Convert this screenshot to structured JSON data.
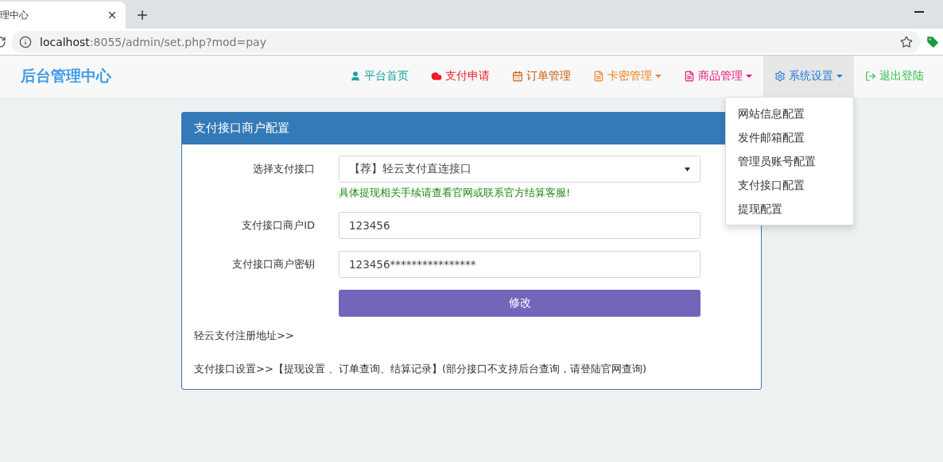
{
  "browser": {
    "tab_title": "理中心",
    "url_host": "localhost",
    "url_rest": ":8055/admin/set.php?mod=pay"
  },
  "nav": {
    "brand": "后台管理中心",
    "items": [
      {
        "label": "平台首页",
        "color": "#17a2a0",
        "dropdown": false,
        "selected": false
      },
      {
        "label": "支付申请",
        "color": "#ee1b24",
        "dropdown": false,
        "selected": false
      },
      {
        "label": "订单管理",
        "color": "#c75c0e",
        "dropdown": false,
        "selected": false
      },
      {
        "label": "卡密管理",
        "color": "#f07f1c",
        "dropdown": true,
        "selected": false
      },
      {
        "label": "商品管理",
        "color": "#e5157a",
        "dropdown": true,
        "selected": false
      },
      {
        "label": "系统设置",
        "color": "#2a7bd6",
        "dropdown": true,
        "selected": true,
        "expanded": true,
        "menu": [
          "网站信息配置",
          "发件邮箱配置",
          "管理员账号配置",
          "支付接口配置",
          "提现配置"
        ]
      },
      {
        "label": "退出登陆",
        "color": "#2ec14a",
        "dropdown": false,
        "selected": false
      }
    ]
  },
  "panel": {
    "title": "支付接口商户配置",
    "fields": [
      {
        "kind": "select",
        "label": "选择支付接口",
        "value": "【荐】轻云支付直连接口",
        "hint": "具体提现相关手续请查看官网或联系官方结算客服!"
      },
      {
        "kind": "input",
        "label": "支付接口商户ID",
        "value": "123456"
      },
      {
        "kind": "input",
        "label": "支付接口商户密钥",
        "value": "123456****************"
      }
    ],
    "button": "修改",
    "register_link": "轻云支付注册地址>>",
    "settings_line": "支付接口设置>>【提现设置 、订单查询、结算记录】(部分接口不支持后台查询，请登陆官网查询)"
  }
}
